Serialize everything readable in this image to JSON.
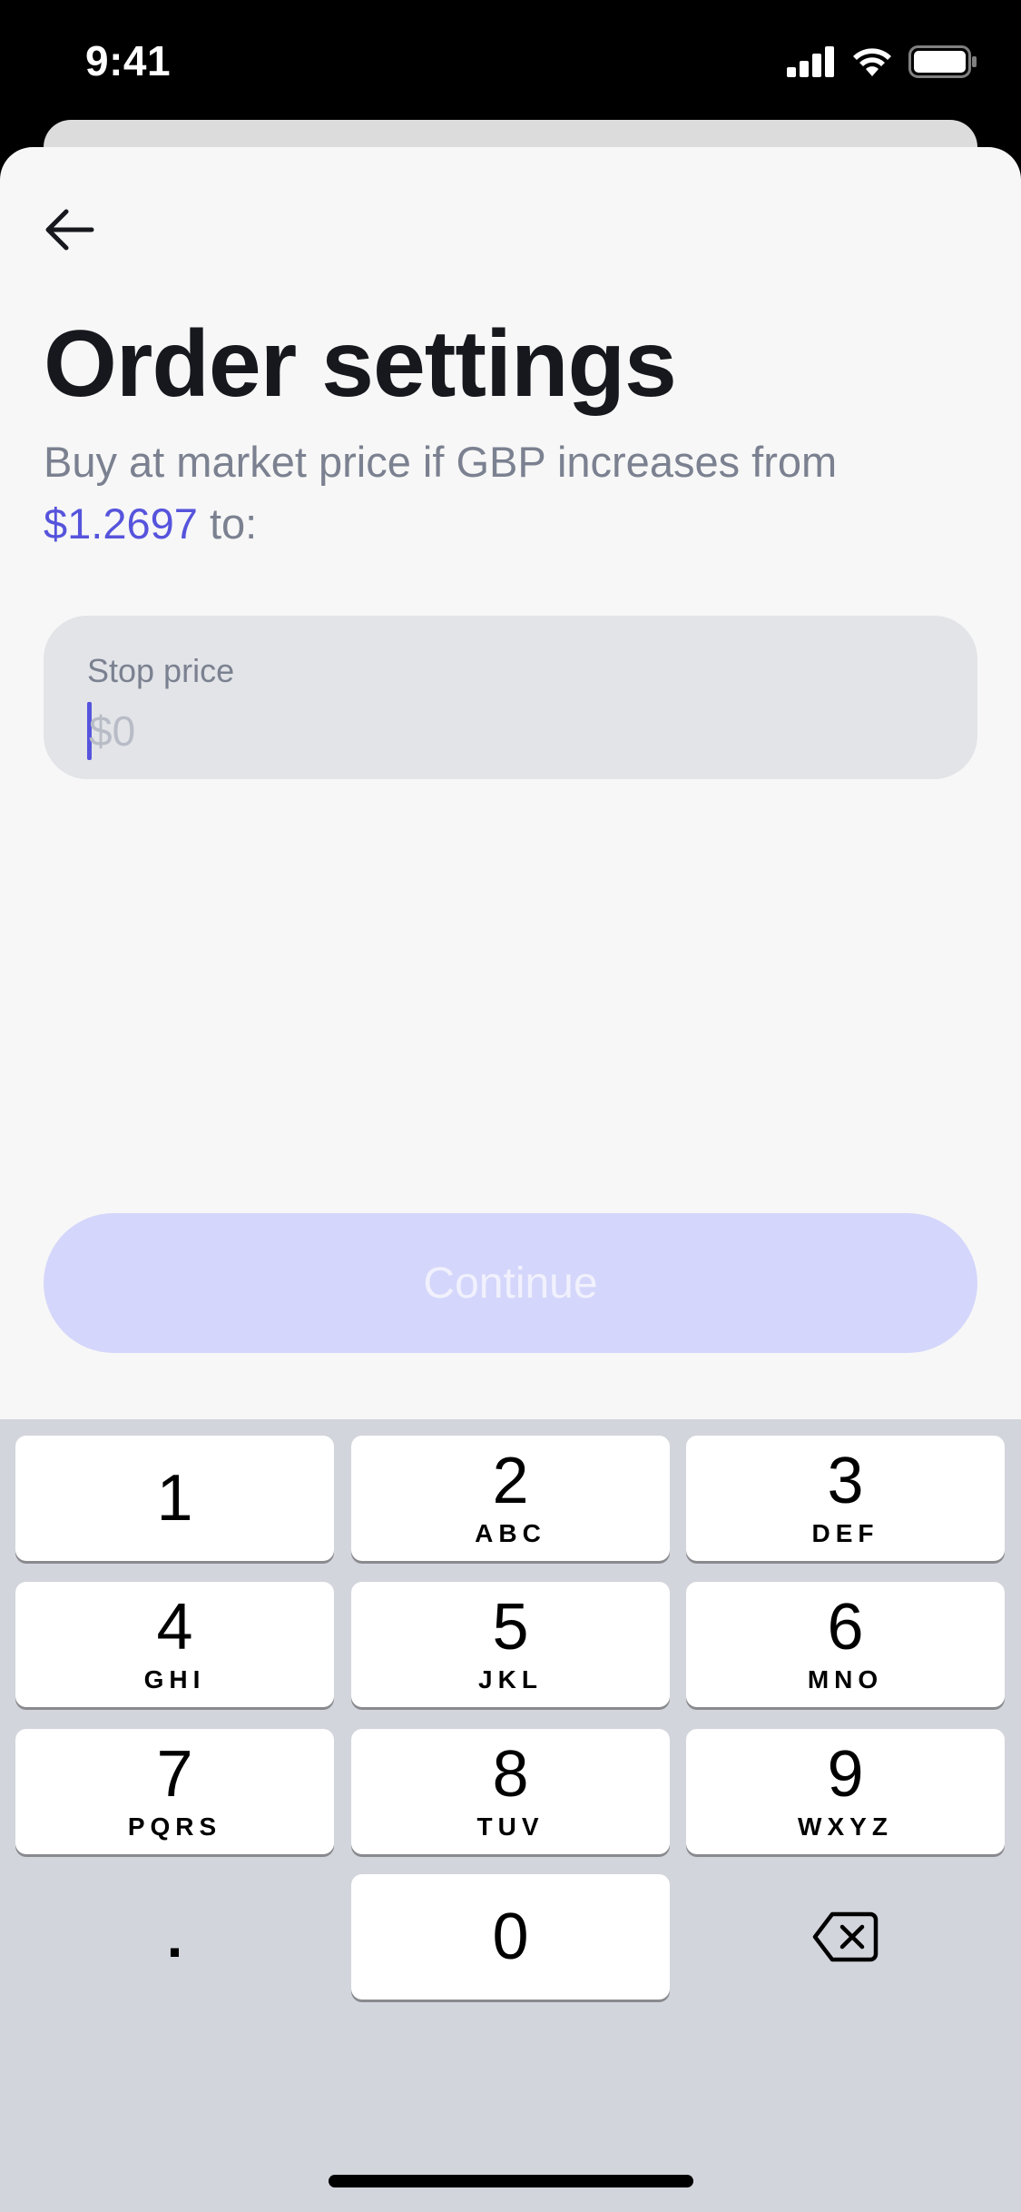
{
  "status_bar": {
    "time": "9:41"
  },
  "header": {
    "back_icon": "arrow-left-icon",
    "title": "Order settings"
  },
  "description": {
    "text_before": "Buy at market price if GBP increases from",
    "price": "$1.2697",
    "text_after": "to:"
  },
  "stop_price": {
    "label": "Stop price",
    "value": "",
    "placeholder": "$0"
  },
  "continue_button": {
    "label": "Continue",
    "enabled": false
  },
  "colors": {
    "accent": "#5654dc",
    "title": "#16181d",
    "muted": "#7b8190",
    "button_disabled": "#d4d6fb",
    "keyboard_bg": "#d3d5dc"
  },
  "keypad": {
    "keys": [
      {
        "digit": "1",
        "letters": ""
      },
      {
        "digit": "2",
        "letters": "ABC"
      },
      {
        "digit": "3",
        "letters": "DEF"
      },
      {
        "digit": "4",
        "letters": "GHI"
      },
      {
        "digit": "5",
        "letters": "JKL"
      },
      {
        "digit": "6",
        "letters": "MNO"
      },
      {
        "digit": "7",
        "letters": "PQRS"
      },
      {
        "digit": "8",
        "letters": "TUV"
      },
      {
        "digit": "9",
        "letters": "WXYZ"
      },
      {
        "digit": "0",
        "letters": ""
      }
    ],
    "decimal": ".",
    "delete_icon": "backspace-icon"
  }
}
